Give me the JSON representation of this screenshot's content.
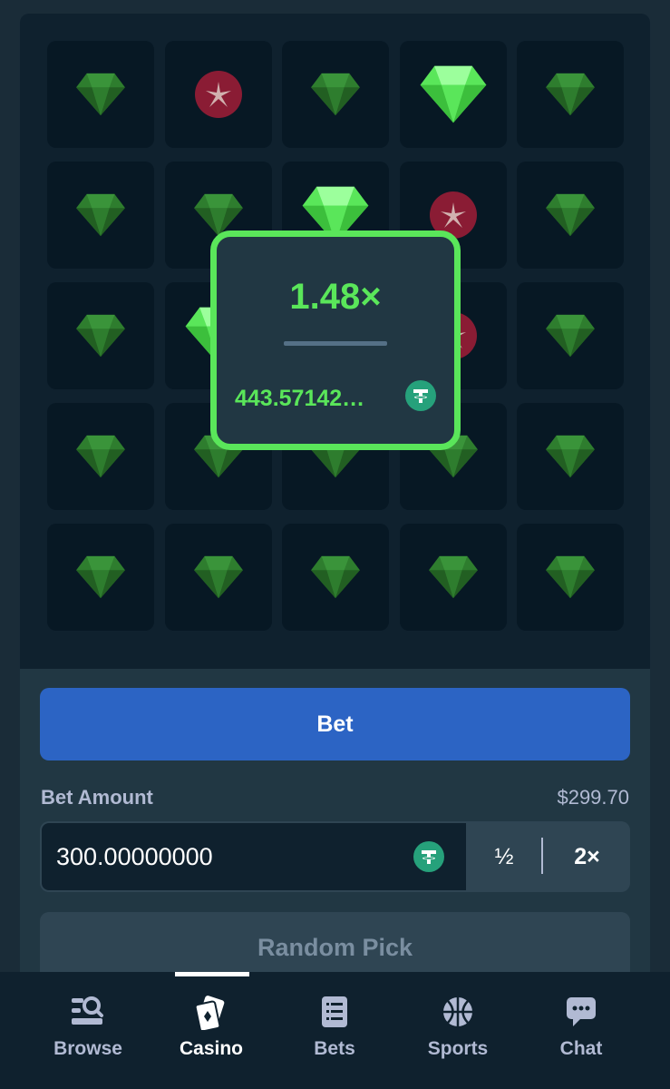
{
  "game": {
    "grid": [
      [
        "gem",
        "mine",
        "gem",
        "gem-revealed",
        "gem"
      ],
      [
        "gem",
        "gem",
        "gem-revealed",
        "mine",
        "gem"
      ],
      [
        "gem",
        "gem-revealed",
        "",
        "mine",
        "gem"
      ],
      [
        "gem",
        "gem",
        "gem",
        "gem",
        "gem"
      ],
      [
        "gem",
        "gem",
        "gem",
        "gem",
        "gem"
      ]
    ],
    "colors": {
      "gem_bright": "#5ae65a",
      "gem_dim": "#2e7d2e",
      "mine": "#8a1c34"
    }
  },
  "popup": {
    "multiplier": "1.48×",
    "payout": "443.57142…",
    "currency_icon": "tether-icon"
  },
  "controls": {
    "bet_label": "Bet",
    "bet_amount_label": "Bet Amount",
    "balance": "$299.70",
    "amount_value": "300.00000000",
    "half_label": "½",
    "double_label": "2×",
    "random_pick_label": "Random Pick"
  },
  "nav": {
    "items": [
      {
        "label": "Browse",
        "icon": "browse-icon"
      },
      {
        "label": "Casino",
        "icon": "casino-icon",
        "active": true
      },
      {
        "label": "Bets",
        "icon": "bets-icon"
      },
      {
        "label": "Sports",
        "icon": "sports-icon"
      },
      {
        "label": "Chat",
        "icon": "chat-icon"
      }
    ]
  }
}
